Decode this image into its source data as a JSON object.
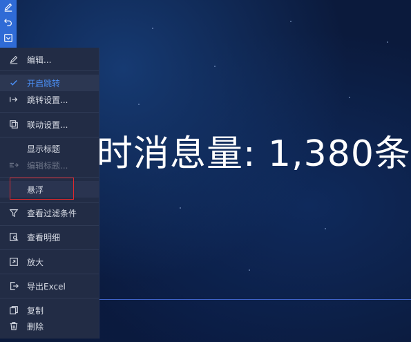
{
  "toolbar": {
    "items": [
      {
        "icon": "pencil-icon"
      },
      {
        "icon": "undo-icon"
      },
      {
        "icon": "checkbox-dropdown-icon"
      }
    ]
  },
  "widget": {
    "value_text": "时消息量: 1,380条"
  },
  "menu": {
    "items": [
      {
        "label": "编辑...",
        "icon": "pencil-icon",
        "state": "normal"
      },
      {
        "label": "开启跳转",
        "icon": "check-icon",
        "state": "checked"
      },
      {
        "label": "跳转设置...",
        "icon": "jump-arrow-icon",
        "state": "normal"
      },
      {
        "label": "联动设置...",
        "icon": "link-settings-icon",
        "state": "normal"
      },
      {
        "label": "显示标题",
        "icon": "",
        "state": "normal"
      },
      {
        "label": "编辑标题...",
        "icon": "edit-title-icon",
        "state": "disabled"
      },
      {
        "label": "悬浮",
        "icon": "",
        "state": "hover"
      },
      {
        "label": "查看过滤条件",
        "icon": "filter-icon",
        "state": "normal"
      },
      {
        "label": "查看明细",
        "icon": "detail-icon",
        "state": "normal"
      },
      {
        "label": "放大",
        "icon": "expand-icon",
        "state": "normal"
      },
      {
        "label": "导出Excel",
        "icon": "export-icon",
        "state": "normal"
      },
      {
        "label": "复制",
        "icon": "copy-icon",
        "state": "normal"
      },
      {
        "label": "删除",
        "icon": "trash-icon",
        "state": "normal"
      }
    ]
  },
  "colors": {
    "accent": "#2f6bd6",
    "checked_text": "#4b8ff5",
    "highlight_box": "#e0282c",
    "menu_bg": "#222c45"
  }
}
